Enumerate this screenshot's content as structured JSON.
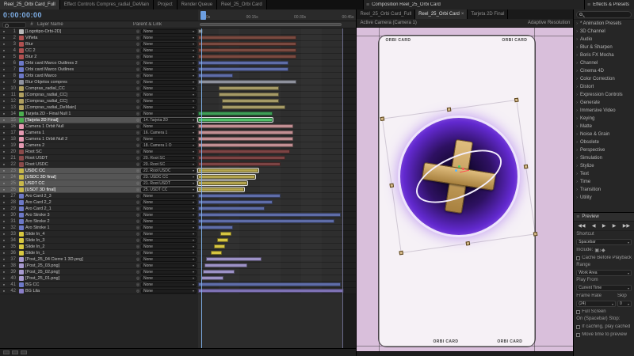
{
  "timeline": {
    "tabs": [
      {
        "label": "Reel_25_Orbi Card_Full",
        "active": true
      },
      {
        "label": "Effect Controls Compres_radial_DeMain",
        "active": false
      },
      {
        "label": "Project",
        "active": false
      },
      {
        "label": "Render Queue",
        "active": false
      },
      {
        "label": "Reel_25_Orbi Card",
        "active": false
      }
    ],
    "timecode": "0:00:00:00",
    "ruler_ticks": [
      "0:00s",
      "00:15s",
      "00:30s",
      "00:45s"
    ],
    "columns": {
      "num": "#",
      "name": "Layer Name",
      "parent": "Parent & Link"
    },
    "layers": [
      {
        "n": 1,
        "name": "[Logotipo-Orbi-2D]",
        "parent": "None",
        "label": "#b8b8b8",
        "bar": [
          0,
          3,
          "#8a8a8a"
        ],
        "sel": false
      },
      {
        "n": 2,
        "name": "Viñeta",
        "parent": "None",
        "label": "#b05050",
        "bar": [
          0,
          62,
          "#7a4a40"
        ],
        "sel": false
      },
      {
        "n": 3,
        "name": "Blur",
        "parent": "None",
        "label": "#b05050",
        "bar": [
          0,
          62,
          "#7a4a40"
        ],
        "sel": false
      },
      {
        "n": 4,
        "name": "CC 2",
        "parent": "None",
        "label": "#b05050",
        "bar": [
          0,
          62,
          "#7a4a40"
        ],
        "sel": false
      },
      {
        "n": 5,
        "name": "Blur 2",
        "parent": "None",
        "label": "#b05050",
        "bar": [
          0,
          62,
          "#7a4a40"
        ],
        "sel": false
      },
      {
        "n": 6,
        "name": "Orbi card Marco Outlines 2",
        "parent": "None",
        "label": "#6d79c8",
        "bar": [
          0,
          57,
          "#5f6da8"
        ],
        "sel": false
      },
      {
        "n": 7,
        "name": "Orbi card Marco Outlines",
        "parent": "None",
        "label": "#6d79c8",
        "bar": [
          0,
          57,
          "#5f6da8"
        ],
        "sel": false
      },
      {
        "n": 8,
        "name": "Orbi card Marco",
        "parent": "None",
        "label": "#6d79c8",
        "bar": [
          0,
          22,
          "#5f6da8"
        ],
        "sel": false
      },
      {
        "n": 9,
        "name": "Blur Objetos compres",
        "parent": "None",
        "label": "#9093a0",
        "bar": [
          0,
          62,
          "#8e919c"
        ],
        "sel": false
      },
      {
        "n": 10,
        "name": "Compras_radial_CC",
        "parent": "None",
        "label": "#b0a060",
        "bar": [
          13,
          38,
          "#a59a66"
        ],
        "sel": false
      },
      {
        "n": 11,
        "name": "[Compras_radial_CC]",
        "parent": "None",
        "label": "#b0a060",
        "bar": [
          13,
          38,
          "#a59a66"
        ],
        "sel": false
      },
      {
        "n": 12,
        "name": "[Compras_radial_CC]",
        "parent": "None",
        "label": "#b0a060",
        "bar": [
          15,
          36,
          "#a59a66"
        ],
        "sel": false
      },
      {
        "n": 13,
        "name": "[Compras_radial_DeMain]",
        "parent": "None",
        "label": "#b0a060",
        "bar": [
          15,
          40,
          "#a59a66"
        ],
        "sel": false
      },
      {
        "n": 14,
        "name": "Tarjeta 2D - Final Null 1",
        "parent": "None",
        "label": "#4caf50",
        "bar": [
          0,
          47,
          "#3f9e57"
        ],
        "sel": false
      },
      {
        "n": 15,
        "name": "[Tarjeta 2D Final]",
        "parent": "14. Tarjeta 2D",
        "label": "#4caf50",
        "bar": [
          0,
          47,
          "#52c06a"
        ],
        "sel": true
      },
      {
        "n": 16,
        "name": "Camera 1 Orbit Null",
        "parent": "None",
        "label": "#e59ab2",
        "bar": [
          0,
          60,
          "#c28f93"
        ],
        "sel": false
      },
      {
        "n": 17,
        "name": "Camera 1",
        "parent": "16. Camera 1",
        "label": "#e59ab2",
        "bar": [
          0,
          60,
          "#c28f93"
        ],
        "sel": false
      },
      {
        "n": 18,
        "name": "Camera 1 Orbit Null 2",
        "parent": "None",
        "label": "#e59ab2",
        "bar": [
          0,
          60,
          "#c28f93"
        ],
        "sel": false
      },
      {
        "n": 19,
        "name": "Camera 2",
        "parent": "18. Camera 1 O",
        "label": "#e59ab2",
        "bar": [
          0,
          60,
          "#c28f93"
        ],
        "sel": false
      },
      {
        "n": 20,
        "name": "Root SC",
        "parent": "None",
        "label": "#8a4a4a",
        "bar": [
          0,
          58,
          "#7c4444"
        ],
        "sel": false
      },
      {
        "n": 21,
        "name": "Root USDT",
        "parent": "20. Root SC",
        "label": "#8a4a4a",
        "bar": [
          0,
          55,
          "#7c4444"
        ],
        "sel": false
      },
      {
        "n": 22,
        "name": "Root USDC",
        "parent": "20. Root SC",
        "label": "#8a4a4a",
        "bar": [
          0,
          52,
          "#7c4444"
        ],
        "sel": false
      },
      {
        "n": 23,
        "name": "USDC CC",
        "parent": "22. Root USDC",
        "label": "#c8b84a",
        "bar": [
          0,
          38,
          "#b3a44e"
        ],
        "sel": true
      },
      {
        "n": 24,
        "name": "[USDC 3D final]",
        "parent": "23. USDC CC",
        "label": "#c8b84a",
        "bar": [
          0,
          36,
          "#b3a44e"
        ],
        "sel": true
      },
      {
        "n": 25,
        "name": "USDT CC",
        "parent": "21. Root USDT",
        "label": "#c8b84a",
        "bar": [
          0,
          31,
          "#b3a44e"
        ],
        "sel": true
      },
      {
        "n": 26,
        "name": "[USDT 3D final]",
        "parent": "25. USDT CC",
        "label": "#c8b84a",
        "bar": [
          0,
          29,
          "#b3a44e"
        ],
        "sel": true
      },
      {
        "n": 27,
        "name": "Aro Card 2_3",
        "parent": "None",
        "label": "#6d79c8",
        "bar": [
          0,
          52,
          "#5f6da8"
        ],
        "sel": false
      },
      {
        "n": 28,
        "name": "Aro Card 2_2",
        "parent": "None",
        "label": "#6d79c8",
        "bar": [
          0,
          47,
          "#5f6da8"
        ],
        "sel": false
      },
      {
        "n": 29,
        "name": "Aro Card 2_1",
        "parent": "None",
        "label": "#6d79c8",
        "bar": [
          0,
          42,
          "#5f6da8"
        ],
        "sel": false
      },
      {
        "n": 30,
        "name": "Aro Stroke 3",
        "parent": "None",
        "label": "#6d79c8",
        "bar": [
          0,
          90,
          "#5f6da8"
        ],
        "sel": false
      },
      {
        "n": 31,
        "name": "Aro Stroke 2",
        "parent": "None",
        "label": "#6d79c8",
        "bar": [
          0,
          86,
          "#5f6da8"
        ],
        "sel": false
      },
      {
        "n": 32,
        "name": "Aro Stroke 1",
        "parent": "None",
        "label": "#6d79c8",
        "bar": [
          0,
          22,
          "#5f6da8"
        ],
        "sel": false
      },
      {
        "n": 33,
        "name": "Slide In_4",
        "parent": "None",
        "label": "#d8c840",
        "bar": [
          14,
          7,
          "#d6c542"
        ],
        "sel": false
      },
      {
        "n": 34,
        "name": "Slide In_3",
        "parent": "None",
        "label": "#d8c840",
        "bar": [
          12,
          7,
          "#d6c542"
        ],
        "sel": false
      },
      {
        "n": 35,
        "name": "Slide In_2",
        "parent": "None",
        "label": "#d8c840",
        "bar": [
          10,
          7,
          "#d6c542"
        ],
        "sel": false
      },
      {
        "n": 36,
        "name": "Slide In_1",
        "parent": "None",
        "label": "#d8c840",
        "bar": [
          8,
          7,
          "#d6c542"
        ],
        "sel": false
      },
      {
        "n": 37,
        "name": "[Post_25_04 Cierre 1 3D.png]",
        "parent": "None",
        "label": "#a89ad0",
        "bar": [
          5,
          35,
          "#9d92c6"
        ],
        "sel": false
      },
      {
        "n": 38,
        "name": "[Post_25_03.png]",
        "parent": "None",
        "label": "#a89ad0",
        "bar": [
          4,
          27,
          "#9d92c6"
        ],
        "sel": false
      },
      {
        "n": 39,
        "name": "[Post_25_02.png]",
        "parent": "None",
        "label": "#a89ad0",
        "bar": [
          3,
          20,
          "#9d92c6"
        ],
        "sel": false
      },
      {
        "n": 40,
        "name": "[Post_25_01.png]",
        "parent": "None",
        "label": "#a89ad0",
        "bar": [
          2,
          14,
          "#9d92c6"
        ],
        "sel": false
      },
      {
        "n": 41,
        "name": "BG CC",
        "parent": "None",
        "label": "#6d79c8",
        "bar": [
          0,
          90,
          "#5f6da8"
        ],
        "sel": false
      },
      {
        "n": 42,
        "name": "BG Lila",
        "parent": "None",
        "label": "#8a7ec8",
        "bar": [
          0,
          92,
          "#7e72b4"
        ],
        "sel": false
      }
    ]
  },
  "composition": {
    "panel_title": "Composition Reel_25_Orbi Card",
    "tabs": [
      {
        "label": "Reel_25_Orbi Card_Full",
        "active": false,
        "close": ""
      },
      {
        "label": "Reel_25_Orbi Card",
        "active": true,
        "close": "×"
      },
      {
        "label": "Tarjeta 2D Final",
        "active": false,
        "close": ""
      }
    ],
    "camera_label": "Active Camera (Camera 1)",
    "resolution_label": "Adaptive Resolution",
    "card_text": "ORBI CARD"
  },
  "effects": {
    "panel_title": "Effects & Presets",
    "search_value": "",
    "categories": [
      "* Animation Presets",
      "3D Channel",
      "Audio",
      "Blur & Sharpen",
      "Boris FX Mocha",
      "Channel",
      "Cinema 4D",
      "Color Correction",
      "Distort",
      "Expression Controls",
      "Generate",
      "Immersive Video",
      "Keying",
      "Matte",
      "Noise & Grain",
      "Obsolete",
      "Perspective",
      "Simulation",
      "Stylize",
      "Text",
      "Time",
      "Transition",
      "Utility"
    ]
  },
  "preview": {
    "panel_title": "Preview",
    "transport": [
      "◀◀",
      "◀",
      "▶",
      "▶",
      "▶▶"
    ],
    "include_icons": [
      "▣",
      "♪",
      "◆"
    ],
    "shortcut_label": "Shortcut",
    "shortcut_value": "Spacebar",
    "include_label": "Include:",
    "cache_label": "Cache Before Playback",
    "range_label": "Range",
    "range_value": "Work Area",
    "play_from_label": "Play From",
    "play_from_value": "Current Time",
    "frame_rate_label": "Frame Rate",
    "skip_label": "Skip",
    "frame_rate_value": "(24)",
    "skip_value": "0",
    "full_screen_label": "Full Screen",
    "stop_label": "On (Spacebar) Stop:",
    "caching_label": "If caching, play cached",
    "move_time_label": "Move time to preview"
  }
}
